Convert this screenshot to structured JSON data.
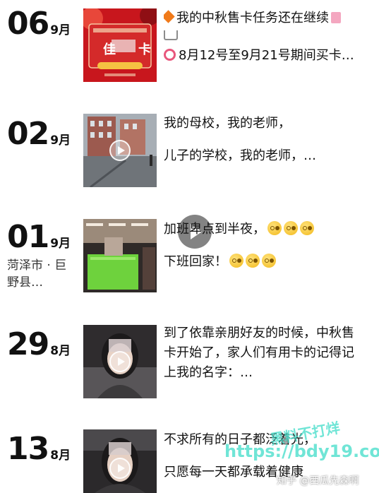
{
  "entries": [
    {
      "day": "06",
      "month": "9月",
      "location": "",
      "lines": [
        "我的中秋售卡任务还在继续",
        "8月12号至9月21号期间买卡…"
      ],
      "has_video": false
    },
    {
      "day": "02",
      "month": "9月",
      "location": "",
      "lines": [
        "我的母校，我的老师，",
        "儿子的学校，我的老师，…"
      ],
      "has_video": true
    },
    {
      "day": "01",
      "month": "9月",
      "location": "菏泽市 · 巨野县…",
      "lines": [
        "加班卑点到半夜，",
        "下班回家！"
      ],
      "has_video": true
    },
    {
      "day": "29",
      "month": "8月",
      "location": "",
      "lines": [
        "到了依靠亲朋好友的时候，中秋售",
        "卡开始了，家人们有用卡的记得记",
        "上我的名字：…"
      ],
      "has_video": true
    },
    {
      "day": "13",
      "month": "8月",
      "location": "",
      "lines": [
        "不求所有的日子都泛着光，",
        "只愿每一天都承载着健康"
      ],
      "has_video": true
    }
  ],
  "thumb_card": {
    "brand_text": "佳",
    "card_text": "卡"
  },
  "watermarks": {
    "site_name": "黑料不打烊",
    "site_url": "https://bdy19.co",
    "zhihu": "知乎 @西瓜先森啊"
  },
  "colors": {
    "card_red": "#c8161d",
    "watermark": "#40dcc8"
  }
}
